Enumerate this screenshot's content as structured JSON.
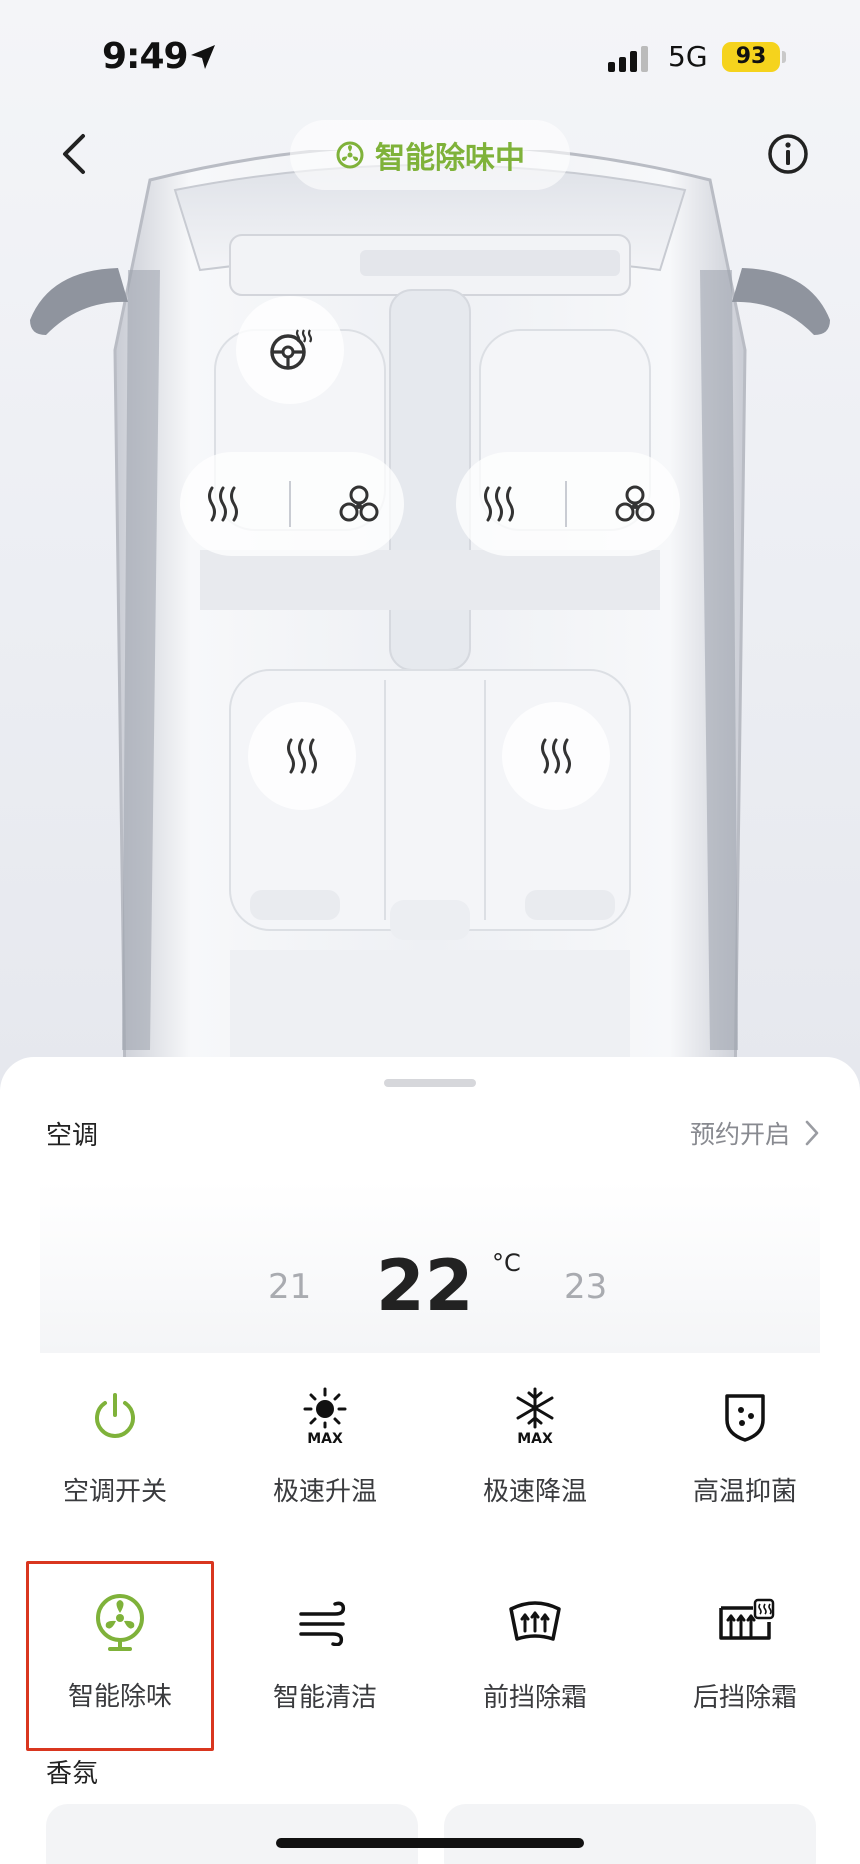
{
  "status_bar": {
    "time": "9:49",
    "network": "5G",
    "battery": "93"
  },
  "header": {
    "mode_text": "智能除味中",
    "back_icon": "chevron-left-icon",
    "info_icon": "info-icon"
  },
  "accent_color": "#7fb23a",
  "cabin": {
    "steering_heat_icon": "steering-wheel-heat-icon",
    "front_seats": [
      {
        "name": "driver",
        "controls": [
          "seat-heat-icon",
          "seat-ventilation-icon"
        ]
      },
      {
        "name": "passenger",
        "controls": [
          "seat-heat-icon",
          "seat-ventilation-icon"
        ]
      }
    ],
    "rear_seats": [
      {
        "name": "rear-left",
        "controls": [
          "seat-heat-icon"
        ]
      },
      {
        "name": "rear-right",
        "controls": [
          "seat-heat-icon"
        ]
      }
    ]
  },
  "climate": {
    "title": "空调",
    "schedule_label": "预约开启",
    "temp_prev": "21",
    "temp_current": "22",
    "temp_unit": "°C",
    "temp_next": "23"
  },
  "functions": [
    {
      "label": "空调开关",
      "icon": "power-icon",
      "active": true
    },
    {
      "label": "极速升温",
      "icon": "sun-max-icon",
      "active": false
    },
    {
      "label": "极速降温",
      "icon": "snowflake-max-icon",
      "active": false
    },
    {
      "label": "高温抑菌",
      "icon": "shield-dots-icon",
      "active": false
    },
    {
      "label": "智能除味",
      "icon": "fan-icon",
      "active": true,
      "selected": true
    },
    {
      "label": "智能清洁",
      "icon": "wind-icon",
      "active": false
    },
    {
      "label": "前挡除霜",
      "icon": "front-defrost-icon",
      "active": false
    },
    {
      "label": "后挡除霜",
      "icon": "rear-defrost-icon",
      "active": false
    }
  ],
  "fragrance": {
    "title": "香氛"
  }
}
